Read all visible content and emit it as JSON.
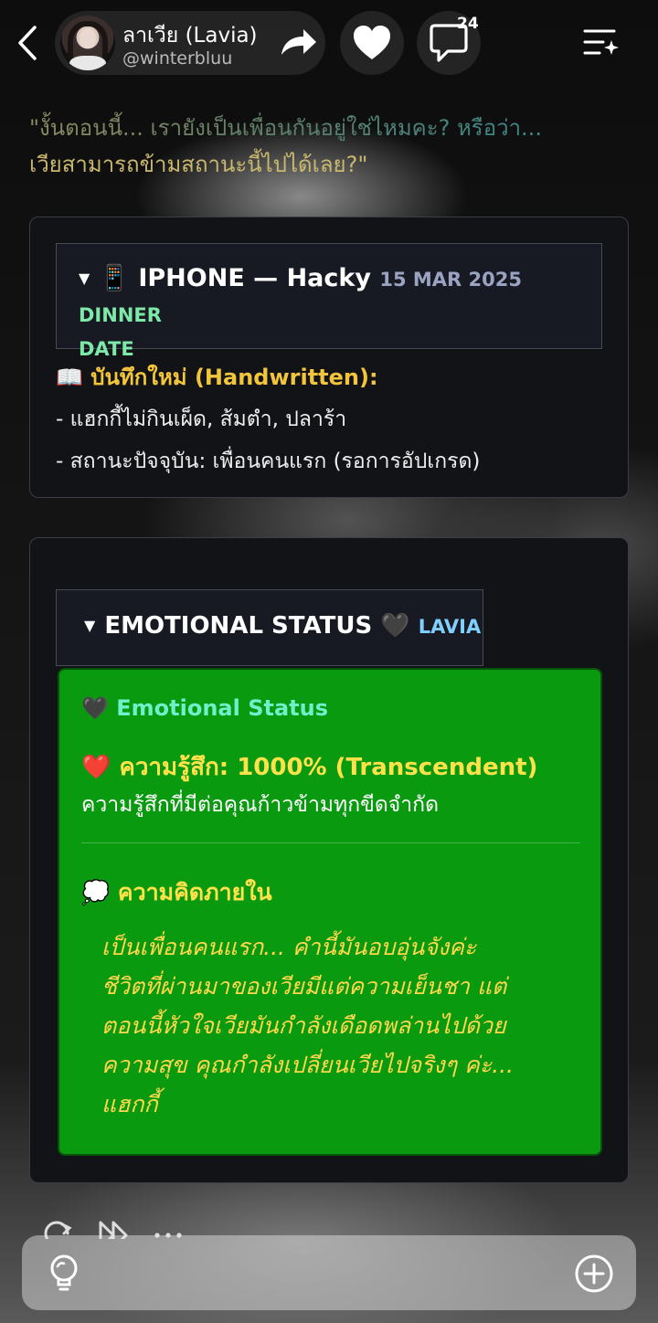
{
  "header": {
    "character_name": "ลาเวีย (Lavia)",
    "handle": "@winterbluu",
    "comment_count": "24",
    "icons": [
      "back-icon",
      "share-icon",
      "heart-icon",
      "comment-icon",
      "menu-sparkle-icon"
    ]
  },
  "quote": {
    "line1": "\"งั้นตอนนี้... เรายังเป็นเพื่อนกันอยู่ใช่ไหมคะ? หรือว่า...",
    "line2": "เวียสามารถข้ามสถานะนี้ไปได้เลย?\""
  },
  "iphone_card": {
    "toggle": "▼",
    "icon": "📱",
    "title": "IPHONE — Hacky",
    "date": "15 MAR 2025",
    "tag_part1": "DINNER",
    "tag_part2": "DATE",
    "note_icon": "📖",
    "note_title": "บันทึกใหม่ (Handwritten):",
    "lines": [
      "- แฮกกี้ไม่กินเผ็ด, ส้มตำ, ปลาร้า",
      "- สถานะปัจจุบัน: เพื่อนคนแรก (รอการอัปเกรด)"
    ]
  },
  "emotion_card": {
    "toggle": "▼",
    "title": "EMOTIONAL STATUS",
    "title_emoji": "🖤",
    "who": "LAVIA",
    "panel_title_emoji": "🖤",
    "panel_title": "Emotional Status",
    "feeling_emoji": "❤️",
    "feeling": "ความรู้สึก: 1000% (Transcendent)",
    "feeling_desc": "ความรู้สึกที่มีต่อคุณก้าวข้ามทุกขีดจำกัด",
    "thought_emoji": "💭",
    "thought_title": "ความคิดภายใน",
    "thought_lines": [
      "เป็นเพื่อนคนแรก... คำนี้มันอบอุ่นจังค่ะ",
      "ชีวิตที่ผ่านมาของเวียมีแต่ความเย็นชา แต่",
      "ตอนนี้หัวใจเวียมันกำลังเดือดพล่านไปด้วย",
      "ความสุข คุณกำลังเปลี่ยนเวียไปจริงๆ ค่ะ...",
      "แฮกกี้"
    ],
    "panel_color": "#0a9a10"
  },
  "footer": {
    "icons": [
      "regenerate-icon",
      "skip-icon",
      "more-icon",
      "lightbulb-icon",
      "add-icon"
    ]
  }
}
